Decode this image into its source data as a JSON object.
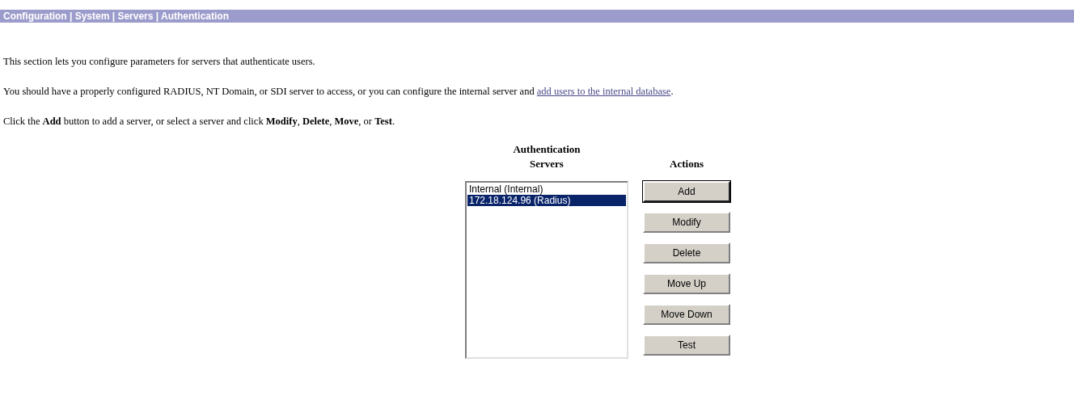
{
  "breadcrumb": "Configuration | System | Servers | Authentication",
  "intro": "This section lets you configure parameters for servers that authenticate users.",
  "requirement": {
    "text": "You should have a properly configured RADIUS, NT Domain, or SDI server to access, or you can configure the internal server and ",
    "link": "add users to the internal database",
    "after": "."
  },
  "instructions": "Click the **Add** button to add a server, or select a server and click **Modify**, **Delete**, **Move**, or **Test**.",
  "servers": {
    "heading": [
      "Authentication",
      "Servers"
    ],
    "items": [
      {
        "label": "Internal (Internal)",
        "selected": false
      },
      {
        "label": "172.18.124.96 (Radius)",
        "selected": true
      }
    ]
  },
  "actions": {
    "heading": "Actions",
    "buttons": [
      {
        "label": "Add",
        "focused": true
      },
      {
        "label": "Modify",
        "focused": false
      },
      {
        "label": "Delete",
        "focused": false
      },
      {
        "label": "Move Up",
        "focused": false
      },
      {
        "label": "Move Down",
        "focused": false
      },
      {
        "label": "Test",
        "focused": false
      }
    ]
  }
}
